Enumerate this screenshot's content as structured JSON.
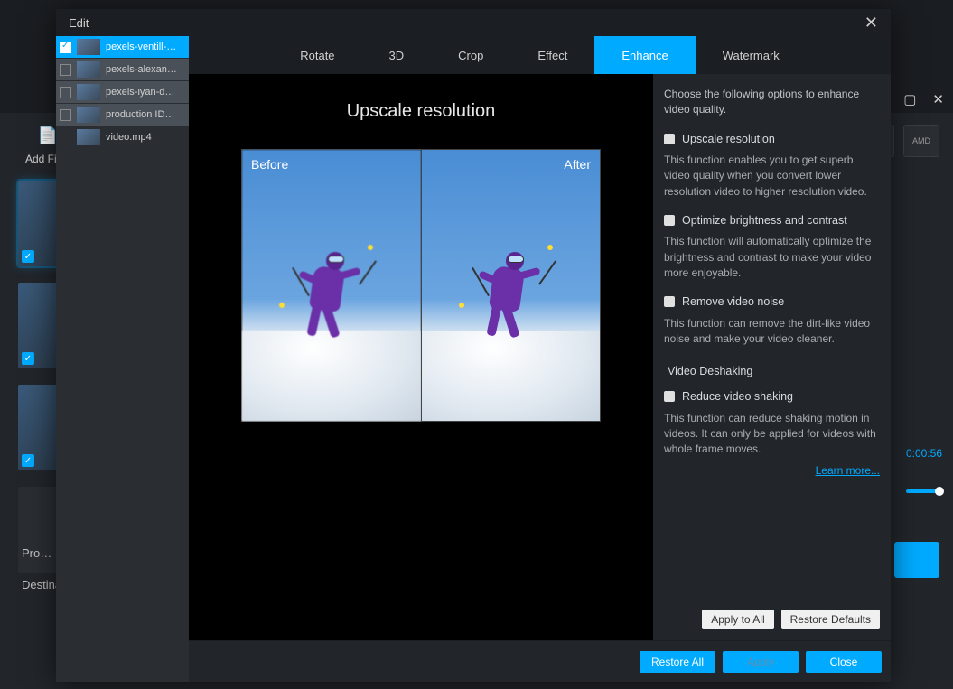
{
  "bg": {
    "add_file_label": "Add Fil…",
    "profile_label": "Pro…",
    "destination_label": "Destina…",
    "timestamp": "0:00:56",
    "amd_label": "AMD"
  },
  "modal": {
    "title": "Edit",
    "tabs": {
      "rotate": "Rotate",
      "threeD": "3D",
      "crop": "Crop",
      "effect": "Effect",
      "enhance": "Enhance",
      "watermark": "Watermark"
    },
    "files": {
      "f0": "pexels-ventill-…",
      "f1": "pexels-alexan…",
      "f2": "pexels-iyan-d…",
      "f3": "production ID…",
      "f4": "video.mp4"
    },
    "preview": {
      "title": "Upscale resolution",
      "before": "Before",
      "after": "After"
    },
    "options": {
      "intro": "Choose the following options to enhance video quality.",
      "upscale_label": "Upscale resolution",
      "upscale_desc": "This function enables you to get superb video quality when you convert lower resolution video to higher resolution video.",
      "optimize_label": "Optimize brightness and contrast",
      "optimize_desc": "This function will automatically optimize the brightness and contrast to make your video more enjoyable.",
      "noise_label": "Remove video noise",
      "noise_desc": "This function can remove the dirt-like video noise and make your video cleaner.",
      "deshake_section": "Video Deshaking",
      "deshake_label": "Reduce video shaking",
      "deshake_desc": "This function can reduce shaking motion in videos. It can only be applied for videos with whole frame moves.",
      "learn_more": "Learn more...",
      "apply_to_all": "Apply to All",
      "restore_defaults": "Restore Defaults"
    },
    "footer": {
      "restore_all": "Restore All",
      "apply": "Apply",
      "close": "Close"
    }
  }
}
